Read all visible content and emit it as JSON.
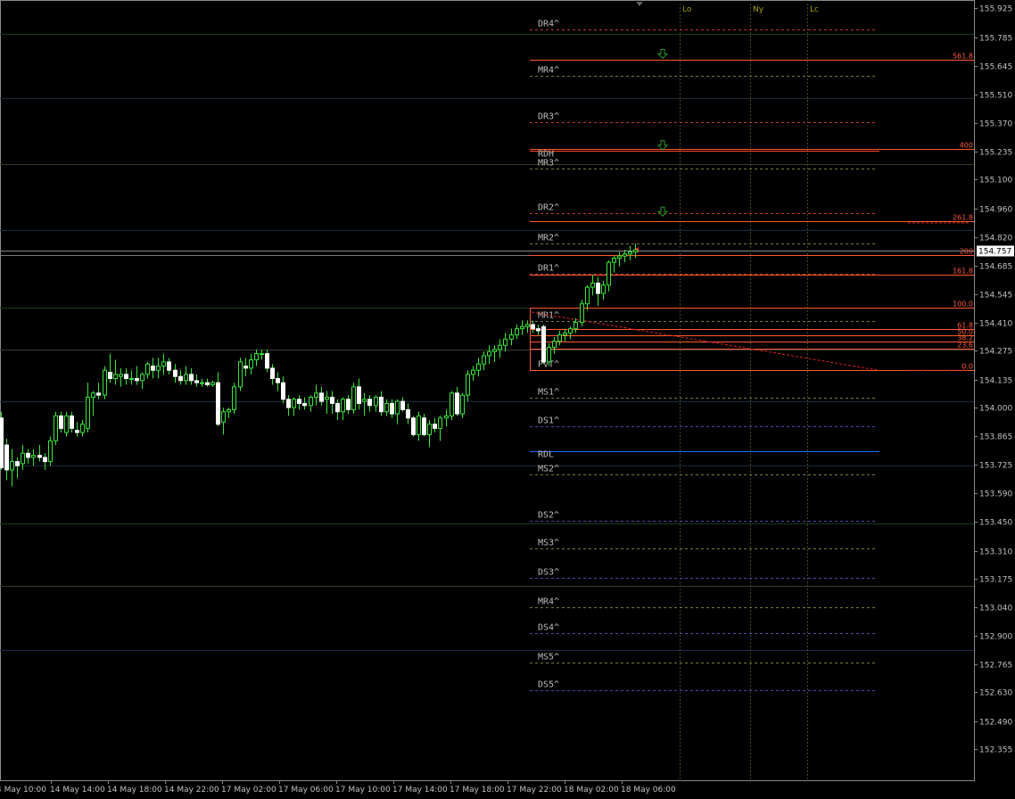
{
  "chart_data": {
    "type": "candlestick",
    "symbol_price": "154.757",
    "y_ticks": [
      "155.925",
      "155.785",
      "155.645",
      "155.510",
      "155.370",
      "155.235",
      "155.100",
      "154.960",
      "154.820",
      "154.685",
      "154.545",
      "154.410",
      "154.275",
      "154.135",
      "154.000",
      "153.865",
      "153.725",
      "153.590",
      "153.450",
      "153.310",
      "153.175",
      "153.040",
      "152.900",
      "152.765",
      "152.630",
      "152.490",
      "152.355"
    ],
    "ylim": [
      152.33,
      155.96
    ],
    "x_labels": [
      "4 May 10:00",
      "14 May 14:00",
      "14 May 18:00",
      "14 May 22:00",
      "17 May 02:00",
      "17 May 06:00",
      "17 May 10:00",
      "17 May 14:00",
      "17 May 18:00",
      "17 May 22:00",
      "18 May 02:00",
      "18 May 06:00"
    ],
    "sessions": [
      "Lo",
      "Ny",
      "Lc"
    ],
    "pivot_levels": [
      {
        "name": "DR4^",
        "price": 155.822,
        "color": "#c0392b",
        "style": "dash"
      },
      {
        "name": "MR4^",
        "price": 155.598,
        "color": "#7a7a3a",
        "style": "dash"
      },
      {
        "name": "DR3^",
        "price": 155.375,
        "color": "#c0392b",
        "style": "dash"
      },
      {
        "name": "RDH",
        "price": 155.238,
        "color": "#ff4a2a",
        "style": "solid"
      },
      {
        "name": "MR3^",
        "price": 155.15,
        "color": "#7a7a3a",
        "style": "dash"
      },
      {
        "name": "DR2^",
        "price": 154.935,
        "color": "#c0392b",
        "style": "dash"
      },
      {
        "name": "MR2^",
        "price": 154.79,
        "color": "#7a7a3a",
        "style": "dash"
      },
      {
        "name": "DR1^",
        "price": 154.645,
        "color": "#c0392b",
        "style": "dash"
      },
      {
        "name": "MR1^",
        "price": 154.415,
        "color": "#7a7a3a",
        "style": "dash"
      },
      {
        "name": "PVT^",
        "price": 154.18,
        "color": "#a0a000",
        "style": "dash"
      },
      {
        "name": "MS1^",
        "price": 154.048,
        "color": "#7a7a3a",
        "style": "dash"
      },
      {
        "name": "DS1^",
        "price": 153.91,
        "color": "#4a4ab0",
        "style": "dash"
      },
      {
        "name": "RDL",
        "price": 153.79,
        "color": "#1e6eff",
        "style": "solid"
      },
      {
        "name": "MS2^",
        "price": 153.68,
        "color": "#7a7a3a",
        "style": "dash"
      },
      {
        "name": "DS2^",
        "price": 153.455,
        "color": "#4a4ab0",
        "style": "dash"
      },
      {
        "name": "MS3^",
        "price": 153.32,
        "color": "#7a7a3a",
        "style": "dash"
      },
      {
        "name": "DS3^",
        "price": 153.18,
        "color": "#4a4ab0",
        "style": "dash"
      },
      {
        "name": "MR4^",
        "price": 153.04,
        "color": "#7a7a3a",
        "style": "dash"
      },
      {
        "name": "DS4^",
        "price": 152.912,
        "color": "#4a4ab0",
        "style": "dash"
      },
      {
        "name": "MS5^",
        "price": 152.77,
        "color": "#7a7a3a",
        "style": "dash"
      },
      {
        "name": "DS5^",
        "price": 152.64,
        "color": "#4a4ab0",
        "style": "dash"
      }
    ],
    "fib_levels": [
      {
        "label": "561.8",
        "price": 155.675
      },
      {
        "label": "400",
        "price": 155.245
      },
      {
        "label": "261.8",
        "price": 154.9
      },
      {
        "label": "200",
        "price": 154.735
      },
      {
        "label": "161.8",
        "price": 154.64
      },
      {
        "label": "100.0",
        "price": 154.48
      },
      {
        "label": "61.8",
        "price": 154.38
      },
      {
        "label": "50.0",
        "price": 154.348
      },
      {
        "label": "38.2",
        "price": 154.318
      },
      {
        "label": "23.6",
        "price": 154.282
      },
      {
        "label": "0.0",
        "price": 154.18
      }
    ],
    "candles": [
      [
        153.95,
        153.98,
        153.7,
        153.71
      ],
      [
        153.82,
        153.85,
        153.65,
        153.7
      ],
      [
        153.7,
        153.8,
        153.62,
        153.74
      ],
      [
        153.74,
        153.76,
        153.66,
        153.72
      ],
      [
        153.73,
        153.82,
        153.7,
        153.78
      ],
      [
        153.78,
        153.8,
        153.73,
        153.76
      ],
      [
        153.76,
        153.8,
        153.72,
        153.77
      ],
      [
        153.77,
        153.82,
        153.74,
        153.76
      ],
      [
        153.76,
        153.78,
        153.7,
        153.74
      ],
      [
        153.74,
        153.86,
        153.72,
        153.84
      ],
      [
        153.84,
        153.98,
        153.82,
        153.96
      ],
      [
        153.96,
        153.98,
        153.88,
        153.9
      ],
      [
        153.88,
        153.98,
        153.86,
        153.96
      ],
      [
        153.96,
        153.98,
        153.88,
        153.9
      ],
      [
        153.89,
        153.93,
        153.86,
        153.88
      ],
      [
        153.88,
        153.94,
        153.86,
        153.92
      ],
      [
        153.9,
        154.12,
        153.88,
        154.05
      ],
      [
        154.05,
        154.08,
        153.96,
        154.07
      ],
      [
        154.07,
        154.12,
        154.04,
        154.06
      ],
      [
        154.06,
        154.2,
        154.04,
        154.18
      ],
      [
        154.17,
        154.26,
        154.12,
        154.14
      ],
      [
        154.14,
        154.23,
        154.11,
        154.16
      ],
      [
        154.15,
        154.19,
        154.1,
        154.16
      ],
      [
        154.16,
        154.19,
        154.11,
        154.14
      ],
      [
        154.14,
        154.18,
        154.11,
        154.14
      ],
      [
        154.14,
        154.2,
        154.11,
        154.13
      ],
      [
        154.13,
        154.17,
        154.09,
        154.16
      ],
      [
        154.16,
        154.22,
        154.14,
        154.21
      ],
      [
        154.2,
        154.24,
        154.14,
        154.18
      ],
      [
        154.18,
        154.24,
        154.14,
        154.2
      ],
      [
        154.2,
        154.26,
        154.16,
        154.22
      ],
      [
        154.22,
        154.24,
        154.16,
        154.18
      ],
      [
        154.18,
        154.21,
        154.12,
        154.15
      ],
      [
        154.15,
        154.18,
        154.11,
        154.13
      ],
      [
        154.13,
        154.2,
        154.11,
        154.16
      ],
      [
        154.16,
        154.19,
        154.11,
        154.13
      ],
      [
        154.13,
        154.16,
        154.1,
        154.12
      ],
      [
        154.12,
        154.14,
        154.1,
        154.12
      ],
      [
        154.12,
        154.14,
        154.1,
        154.11
      ],
      [
        154.11,
        154.13,
        154.1,
        154.12
      ],
      [
        154.12,
        154.17,
        153.91,
        153.92
      ],
      [
        153.93,
        154.0,
        153.87,
        153.98
      ],
      [
        153.98,
        154.0,
        153.95,
        153.99
      ],
      [
        153.99,
        154.12,
        153.97,
        154.1
      ],
      [
        154.1,
        154.24,
        154.08,
        154.22
      ],
      [
        154.2,
        154.24,
        154.15,
        154.19
      ],
      [
        154.19,
        154.26,
        154.16,
        154.23
      ],
      [
        154.23,
        154.28,
        154.2,
        154.26
      ],
      [
        154.26,
        154.28,
        154.23,
        154.26
      ],
      [
        154.26,
        154.28,
        154.17,
        154.19
      ],
      [
        154.19,
        154.21,
        154.11,
        154.14
      ],
      [
        154.14,
        154.17,
        154.08,
        154.12
      ],
      [
        154.12,
        154.15,
        154.02,
        154.04
      ],
      [
        154.04,
        154.06,
        153.96,
        154.0
      ],
      [
        154.0,
        154.05,
        153.96,
        154.04
      ],
      [
        154.04,
        154.06,
        153.99,
        154.02
      ],
      [
        154.02,
        154.05,
        153.99,
        154.01
      ],
      [
        154.01,
        154.06,
        153.98,
        154.05
      ],
      [
        154.05,
        154.11,
        154.01,
        154.07
      ],
      [
        154.07,
        154.1,
        154.01,
        154.03
      ],
      [
        154.04,
        154.08,
        153.97,
        154.05
      ],
      [
        154.05,
        154.08,
        153.97,
        154.02
      ],
      [
        154.02,
        154.04,
        153.94,
        153.98
      ],
      [
        153.98,
        154.05,
        153.94,
        154.04
      ],
      [
        154.04,
        154.06,
        153.97,
        153.99
      ],
      [
        153.99,
        154.12,
        153.97,
        154.1
      ],
      [
        154.1,
        154.14,
        153.99,
        154.02
      ],
      [
        154.03,
        154.07,
        153.96,
        154.04
      ],
      [
        154.04,
        154.06,
        153.98,
        154.01
      ],
      [
        154.01,
        154.06,
        153.98,
        154.05
      ],
      [
        154.05,
        154.08,
        153.96,
        153.98
      ],
      [
        153.98,
        154.04,
        153.96,
        154.02
      ],
      [
        154.02,
        154.04,
        153.95,
        153.97
      ],
      [
        153.97,
        154.04,
        153.92,
        154.03
      ],
      [
        154.03,
        154.05,
        153.98,
        153.99
      ],
      [
        153.99,
        154.02,
        153.92,
        153.95
      ],
      [
        153.95,
        153.96,
        153.86,
        153.87
      ],
      [
        153.87,
        153.98,
        153.84,
        153.96
      ],
      [
        153.95,
        153.97,
        153.86,
        153.87
      ],
      [
        153.87,
        153.94,
        153.81,
        153.92
      ],
      [
        153.92,
        153.95,
        153.88,
        153.9
      ],
      [
        153.9,
        153.96,
        153.84,
        153.95
      ],
      [
        153.95,
        153.99,
        153.91,
        153.96
      ],
      [
        153.96,
        154.08,
        153.94,
        154.07
      ],
      [
        154.07,
        154.1,
        153.96,
        153.97
      ],
      [
        153.97,
        154.07,
        153.95,
        154.06
      ],
      [
        154.06,
        154.18,
        154.03,
        154.16
      ],
      [
        154.16,
        154.2,
        154.13,
        154.18
      ],
      [
        154.18,
        154.24,
        154.15,
        154.21
      ],
      [
        154.21,
        154.27,
        154.18,
        154.25
      ],
      [
        154.25,
        154.3,
        154.21,
        154.27
      ],
      [
        154.27,
        154.3,
        154.22,
        154.28
      ],
      [
        154.28,
        154.33,
        154.24,
        154.3
      ],
      [
        154.3,
        154.36,
        154.27,
        154.33
      ],
      [
        154.33,
        154.38,
        154.3,
        154.35
      ],
      [
        154.35,
        154.4,
        154.33,
        154.38
      ],
      [
        154.38,
        154.42,
        154.35,
        154.39
      ],
      [
        154.39,
        154.42,
        154.36,
        154.4
      ],
      [
        154.4,
        154.42,
        154.36,
        154.38
      ],
      [
        154.38,
        154.4,
        154.35,
        154.37
      ],
      [
        154.39,
        154.4,
        154.21,
        154.22
      ],
      [
        154.22,
        154.31,
        154.2,
        154.29
      ],
      [
        154.29,
        154.34,
        154.26,
        154.32
      ],
      [
        154.32,
        154.37,
        154.3,
        154.35
      ],
      [
        154.35,
        154.38,
        154.32,
        154.36
      ],
      [
        154.36,
        154.39,
        154.33,
        154.38
      ],
      [
        154.38,
        154.43,
        154.36,
        154.41
      ],
      [
        154.41,
        154.52,
        154.39,
        154.5
      ],
      [
        154.5,
        154.59,
        154.47,
        154.58
      ],
      [
        154.58,
        154.64,
        154.54,
        154.6
      ],
      [
        154.6,
        154.63,
        154.49,
        154.55
      ],
      [
        154.55,
        154.61,
        154.52,
        154.59
      ],
      [
        154.59,
        154.71,
        154.56,
        154.7
      ],
      [
        154.7,
        154.73,
        154.65,
        154.72
      ],
      [
        154.72,
        154.75,
        154.68,
        154.73
      ],
      [
        154.73,
        154.76,
        154.7,
        154.74
      ],
      [
        154.74,
        154.78,
        154.71,
        154.75
      ],
      [
        154.75,
        154.79,
        154.72,
        154.76
      ]
    ]
  }
}
